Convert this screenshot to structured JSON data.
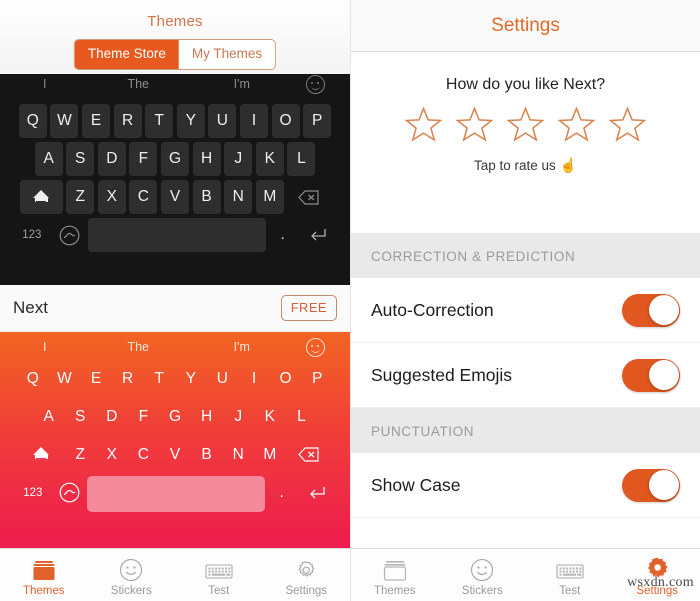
{
  "left": {
    "header": {
      "title": "Themes",
      "segments": [
        {
          "label": "Theme Store",
          "active": true
        },
        {
          "label": "My Themes",
          "active": false
        }
      ]
    },
    "dark_keyboard": {
      "suggestions": [
        "I",
        "The",
        "I'm"
      ],
      "emoji_icon": "smiley-circle-icon",
      "row1": [
        "Q",
        "W",
        "E",
        "R",
        "T",
        "Y",
        "U",
        "I",
        "O",
        "P"
      ],
      "row2": [
        "A",
        "S",
        "D",
        "F",
        "G",
        "H",
        "J",
        "K",
        "L"
      ],
      "row3": [
        "Z",
        "X",
        "C",
        "V",
        "B",
        "N",
        "M"
      ],
      "shift_icon": "shift-icon",
      "backspace_icon": "backspace-icon",
      "numeric_label": "123",
      "wave_icon": "wave-circle-icon",
      "space_label": "",
      "period_label": ".",
      "return_icon": "return-icon"
    },
    "theme_row": {
      "name": "Next",
      "price_label": "FREE"
    },
    "orange_keyboard": {
      "suggestions": [
        "I",
        "The",
        "I'm"
      ],
      "emoji_icon": "smiley-circle-icon",
      "row1": [
        "Q",
        "W",
        "E",
        "R",
        "T",
        "Y",
        "U",
        "I",
        "O",
        "P"
      ],
      "row2": [
        "A",
        "S",
        "D",
        "F",
        "G",
        "H",
        "J",
        "K",
        "L"
      ],
      "row3": [
        "Z",
        "X",
        "C",
        "V",
        "B",
        "N",
        "M"
      ],
      "shift_icon": "shift-icon",
      "backspace_icon": "backspace-icon",
      "numeric_label": "123",
      "wave_icon": "wave-circle-icon",
      "period_label": ".",
      "return_icon": "return-icon"
    },
    "tabbar": [
      {
        "label": "Themes",
        "icon": "themes-folder-icon",
        "active": true
      },
      {
        "label": "Stickers",
        "icon": "smiley-icon",
        "active": false
      },
      {
        "label": "Test",
        "icon": "keyboard-icon",
        "active": false
      },
      {
        "label": "Settings",
        "icon": "gear-icon",
        "active": false
      }
    ]
  },
  "right": {
    "header": {
      "title": "Settings"
    },
    "rating": {
      "question": "How do you like Next?",
      "stars": 5,
      "filled": 0,
      "tap_text": "Tap to rate us",
      "finger_emoji": "☝️"
    },
    "sections": [
      {
        "title": "CORRECTION & PREDICTION",
        "rows": [
          {
            "label": "Auto-Correction",
            "toggle": "on"
          },
          {
            "label": "Suggested Emojis",
            "toggle": "on"
          }
        ]
      },
      {
        "title": "PUNCTUATION",
        "rows": [
          {
            "label": "Show Case",
            "toggle": "on"
          }
        ]
      }
    ],
    "tabbar": [
      {
        "label": "Themes",
        "icon": "themes-folder-icon",
        "active": false
      },
      {
        "label": "Stickers",
        "icon": "smiley-icon",
        "active": false
      },
      {
        "label": "Test",
        "icon": "keyboard-icon",
        "active": false
      },
      {
        "label": "Settings",
        "icon": "gear-icon",
        "active": true
      }
    ]
  },
  "watermark": "wsxdn.com",
  "colors": {
    "accent_orange": "#e8591f",
    "title_orange": "#e36b2a",
    "toggle_on": "#e0571f",
    "dark_key": "#2e2e2e",
    "dark_bg": "#151515",
    "gradient_top": "#f26522",
    "gradient_bottom": "#ed1c4e",
    "spacebar_pink": "#f58a9c"
  }
}
